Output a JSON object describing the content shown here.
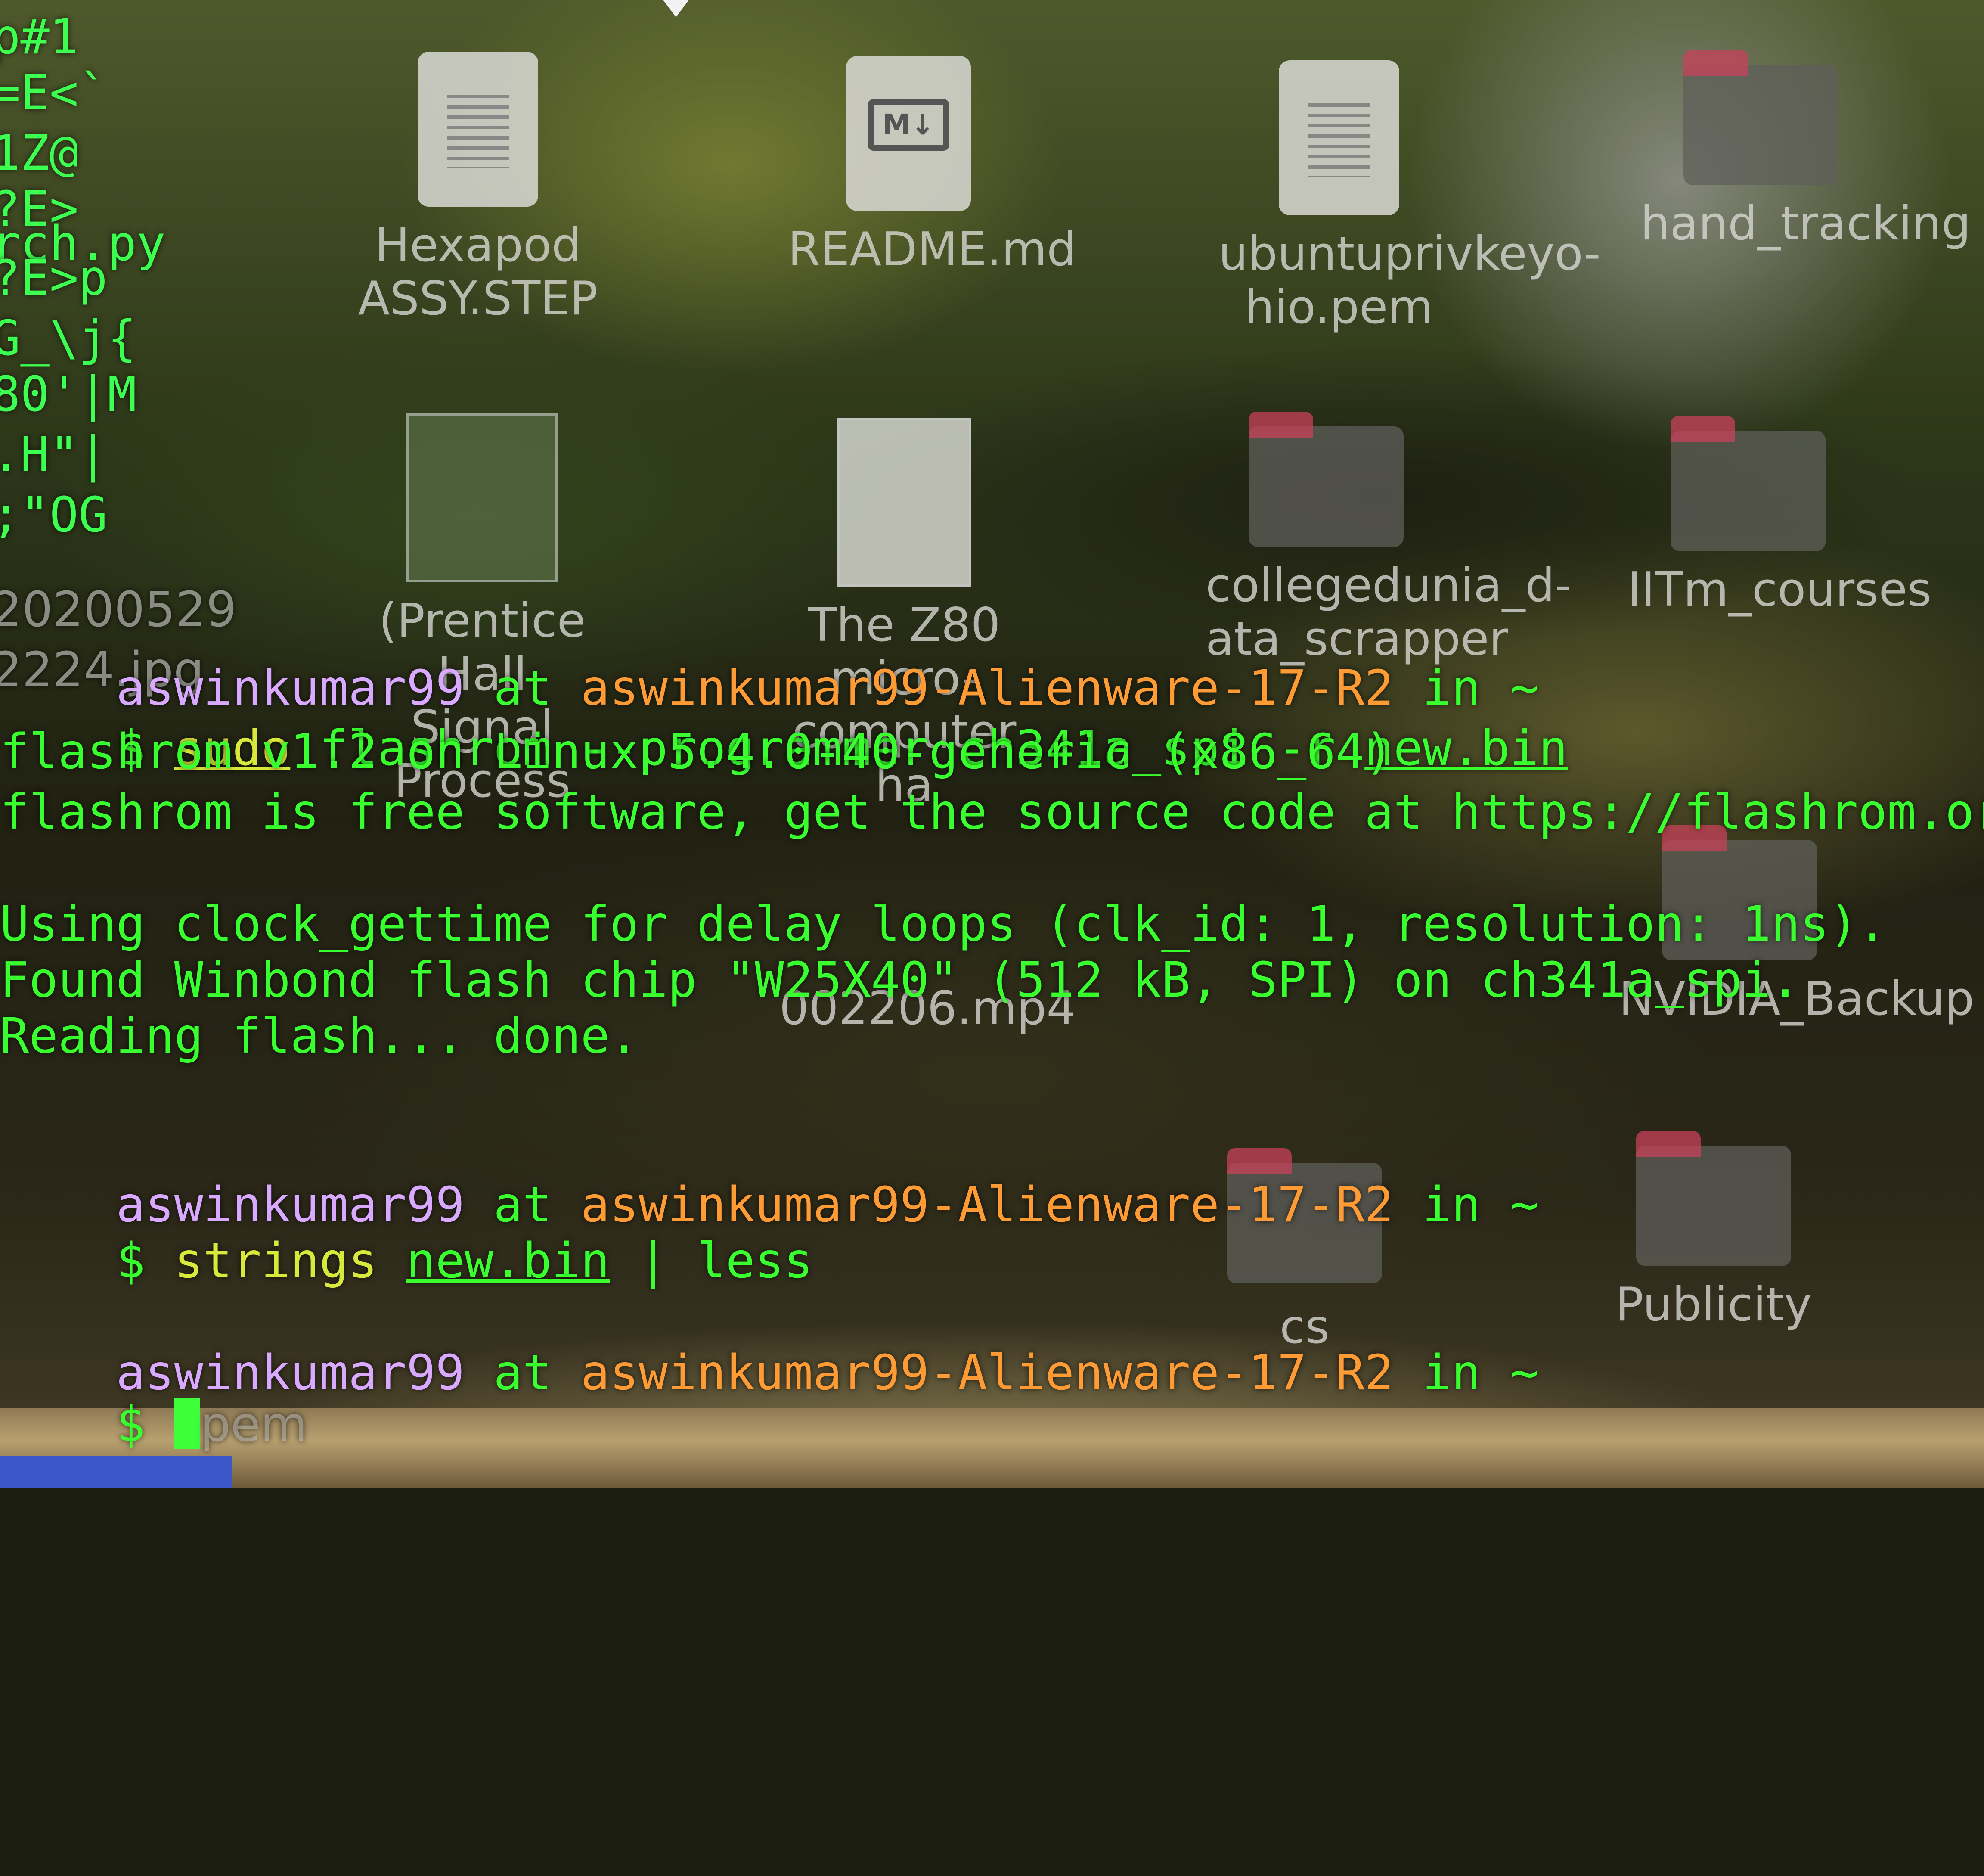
{
  "desktop": {
    "icons": [
      {
        "name": "Hexapod ASSY.STEP",
        "line1": "Hexapod",
        "line2": "ASSY.STEP",
        "type": "document"
      },
      {
        "name": "README.md",
        "line1": "README.md",
        "line2": "",
        "type": "markdown"
      },
      {
        "name": "ubuntuprivkeyohio.pem",
        "line1": "ubuntuprivkeyo-",
        "line2": "hio.pem",
        "type": "document"
      },
      {
        "name": "hand_tracking",
        "line1": "hand_tracking",
        "line2": "",
        "type": "folder"
      },
      {
        "name": "(Prentice Hall Signal Process",
        "line1": "(Prentice Hall",
        "line2": "Signal Process",
        "type": "image"
      },
      {
        "name": "The Z80 microcomputer ha",
        "line1": "The Z80 micro-",
        "line2": "computer ha",
        "type": "image"
      },
      {
        "name": "collegedunia_data_scrapper",
        "line1": "collegedunia_d-",
        "line2": "ata_scrapper",
        "type": "folder"
      },
      {
        "name": "IITm_courses",
        "line1": "IITm_courses",
        "line2": "",
        "type": "folder"
      },
      {
        "name": "002206.mp4",
        "line1": "002206.mp4",
        "line2": "",
        "type": "video"
      },
      {
        "name": "NVIDIA_Backup",
        "line1": "NVIDIA_Backup",
        "line2": "",
        "type": "folder"
      },
      {
        "name": "Publicity",
        "line1": "Publicity",
        "line2": "",
        "type": "folder"
      },
      {
        "name": "cs",
        "line1": "cs",
        "line2": "",
        "type": "folder"
      }
    ],
    "markdown_badge": "M↓"
  },
  "terminal": {
    "left_fragments": [
      "p#1",
      "=E<`",
      "1Z@",
      "?E>",
      "rch.py",
      "?E>p",
      "G_\\j{",
      "80'|M",
      ".H\"|",
      ";\"OG",
      "20200529",
      "2224.jpg"
    ],
    "user": "aswinkumar99",
    "at": " at ",
    "host": "aswinkumar99-Alienware-17-R2",
    "in": " in ~",
    "prompt_symbol": "$ ",
    "cmd1": {
      "sudo": "sudo",
      "rest1": " flashrom --programmer ch341a_spi -r ",
      "file": "new.bin"
    },
    "output": [
      "flashrom v1.2 on Linux 5.4.0-40-generic (x86_64)",
      "flashrom is free software, get the source code at https://flashrom.org",
      "",
      "Using clock_gettime for delay loops (clk_id: 1, resolution: 1ns).",
      "Found Winbond flash chip \"W25X40\" (512 kB, SPI) on ch341a_spi.",
      "Reading flash... done."
    ],
    "cmd2": {
      "prog": "strings",
      "file": "new.bin",
      "rest": " | less"
    },
    "input_hint": "pem"
  }
}
